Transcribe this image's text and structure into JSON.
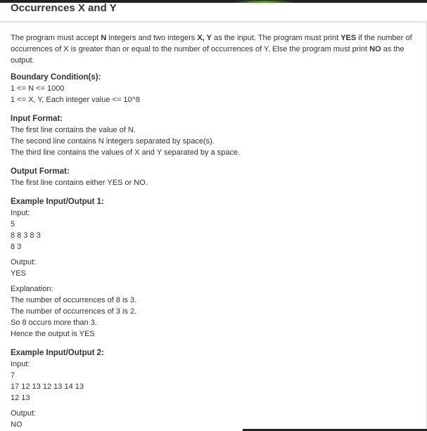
{
  "title": "Occurrences X and Y",
  "description": {
    "p1": "The program must accept ",
    "n": "N",
    "p2": " integers and two integers ",
    "xy": "X, Y",
    "p3": " as the input. The program must print ",
    "yes": "YES",
    "p4": " if the number of occurrences of X is greater than or equal to the number of occurrences of Y. Else the program must print ",
    "no": "NO",
    "p5": " as the output."
  },
  "boundary": {
    "heading": "Boundary Condition(s):",
    "lines": [
      "1 <= N <= 1000",
      "1 <= X, Y, Each integer value <= 10^8"
    ]
  },
  "input_format": {
    "heading": "Input Format:",
    "lines": [
      "The first line contains the value of N.",
      "The second line contains N integers separated by space(s).",
      "The third line contains the values of X and Y separated by a space."
    ]
  },
  "output_format": {
    "heading": "Output Format:",
    "lines": [
      "The first line contains either YES or NO."
    ]
  },
  "example1": {
    "heading": "Example Input/Output 1:",
    "input_label": "Input:",
    "input_lines": [
      "5",
      "8 8 3 8 3",
      "8 3"
    ],
    "output_label": "Output:",
    "output_lines": [
      "YES"
    ],
    "explanation_label": "Explanation:",
    "explanation_lines": [
      "The number of occurrences of 8 is 3.",
      "The number of occurrences of 3 is 2.",
      "So 8 occurs more than 3.",
      "Hence the output is YES"
    ]
  },
  "example2": {
    "heading": "Example Input/Output 2:",
    "input_label": "Input:",
    "input_lines": [
      "7",
      "17 12 13 12 13 14 13",
      "12 13"
    ],
    "output_label": "Output:",
    "output_lines": [
      "NO"
    ]
  }
}
